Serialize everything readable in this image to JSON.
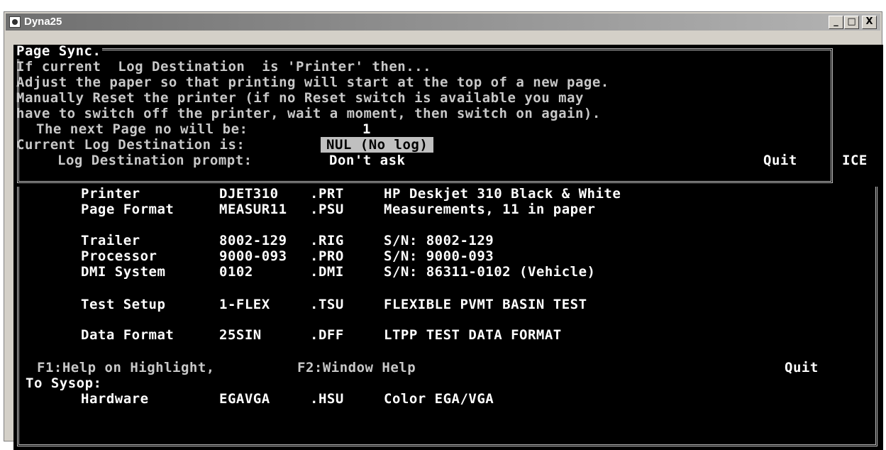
{
  "window": {
    "title": "Dyna25",
    "buttons": {
      "minimize": "_",
      "maximize": "□",
      "close": "X"
    }
  },
  "dialog": {
    "title": "Page Sync.",
    "lines": [
      "If current  Log Destination  is 'Printer' then...",
      "Adjust the paper so that printing will start at the top of a new page.",
      "Manually Reset the printer (if no Reset switch is available you may",
      "have to switch off the printer, wait a moment, then switch on again)."
    ],
    "next_page_label": "The next Page no will be:",
    "next_page_value": "1",
    "current_dest_label": "Current Log Destination is:",
    "current_dest_value": "NUL (No log)",
    "prompt_label": "Log Destination prompt:",
    "prompt_value": "Don't ask",
    "quit": "Quit",
    "right_text": "ICE"
  },
  "config": [
    {
      "label": "Printer",
      "file": "DJET310",
      "ext": ".PRT",
      "desc": "HP Deskjet 310 Black & White"
    },
    {
      "label": "Page Format",
      "file": "MEASUR11",
      "ext": ".PSU",
      "desc": "Measurements, 11 in paper"
    },
    {
      "label": "Trailer",
      "file": "8002-129",
      "ext": ".RIG",
      "desc": "S/N: 8002-129"
    },
    {
      "label": "Processor",
      "file": "9000-093",
      "ext": ".PRO",
      "desc": "S/N: 9000-093"
    },
    {
      "label": "DMI System",
      "file": "0102",
      "ext": ".DMI",
      "desc": "S/N: 86311-0102 (Vehicle)"
    },
    {
      "label": "Test Setup",
      "file": "1-FLEX",
      "ext": ".TSU",
      "desc": "FLEXIBLE PVMT BASIN TEST"
    },
    {
      "label": "Data Format",
      "file": "25SIN",
      "ext": ".DFF",
      "desc": "LTPP TEST DATA FORMAT"
    }
  ],
  "footer": {
    "f1": "F1:Help on Highlight,",
    "f2": "F2:Window Help",
    "quit": "Quit",
    "sysop": "To Sysop:"
  },
  "hardware": {
    "label": "Hardware",
    "file": "EGAVGA",
    "ext": ".HSU",
    "desc": "Color EGA/VGA"
  }
}
